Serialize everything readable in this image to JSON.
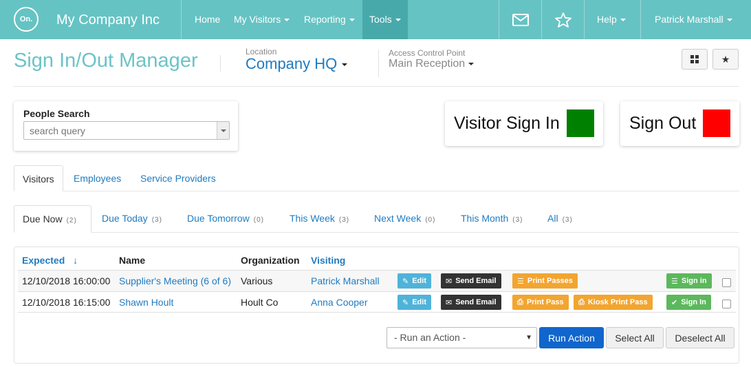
{
  "nav": {
    "logo_text": "On.",
    "brand": "My Company Inc",
    "items": [
      {
        "label": "Home"
      },
      {
        "label": "My Visitors"
      },
      {
        "label": "Reporting"
      },
      {
        "label": "Tools"
      }
    ],
    "help": "Help",
    "user": "Patrick Marshall",
    "icons": [
      "mail-icon",
      "star-icon"
    ]
  },
  "header": {
    "title": "Sign In/Out Manager",
    "location_label": "Location",
    "location_value": "Company HQ",
    "acp_label": "Access Control Point",
    "acp_value": "Main Reception"
  },
  "search": {
    "label": "People Search",
    "placeholder": "search query"
  },
  "actions": {
    "visitor_sign_in": "Visitor Sign In",
    "sign_out": "Sign Out",
    "sign_in_color": "#008000",
    "sign_out_color": "#ff0000"
  },
  "type_tabs": [
    {
      "label": "Visitors"
    },
    {
      "label": "Employees"
    },
    {
      "label": "Service Providers"
    }
  ],
  "period_tabs": [
    {
      "label": "Due Now",
      "count": "(2)"
    },
    {
      "label": "Due Today",
      "count": "(3)"
    },
    {
      "label": "Due Tomorrow",
      "count": "(0)"
    },
    {
      "label": "This Week",
      "count": "(3)"
    },
    {
      "label": "Next Week",
      "count": "(0)"
    },
    {
      "label": "This Month",
      "count": "(3)"
    },
    {
      "label": "All",
      "count": "(3)"
    }
  ],
  "table": {
    "headers": {
      "expected": "Expected",
      "sort_arrow": "↓",
      "name": "Name",
      "organization": "Organization",
      "visiting": "Visiting"
    },
    "rows": [
      {
        "expected": "12/10/2018 16:00:00",
        "name": "Supplier's Meeting (6 of 6)",
        "organization": "Various",
        "visiting": "Patrick Marshall",
        "edit": "Edit",
        "email": "Send Email",
        "print": "Print Passes",
        "signin": "Sign in"
      },
      {
        "expected": "12/10/2018 16:15:00",
        "name": "Shawn Hoult",
        "organization": "Hoult Co",
        "visiting": "Anna Cooper",
        "edit": "Edit",
        "email": "Send Email",
        "print": "Print Pass",
        "kiosk": "Kiosk Print Pass",
        "signin": "Sign In"
      }
    ]
  },
  "footer": {
    "action_select": "- Run an Action -",
    "run_action": "Run Action",
    "select_all": "Select All",
    "deselect_all": "Deselect All"
  }
}
